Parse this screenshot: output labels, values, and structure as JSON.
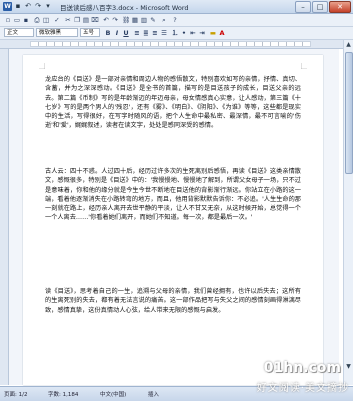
{
  "window": {
    "title": "目送读后感八百字3.docx - Microsoft Word"
  },
  "formatting": {
    "style": "正文",
    "font": "微软雅黑",
    "size": "五号"
  },
  "document": {
    "paragraphs": [
      "龙应台的《目送》是一部对亲情和周边人物的感悟散文，特别喜欢如写的亲情，抒情、真切、含蓄，并为之深深感动。《目送》是全书的首篇，描写的是目送孩子的成长，目送父亲的远去。第二篇《币制》写的是年龄渐迈的年迈母亲，母女情感真心实意，让人感动，第三篇《十七岁》写的是两个男人的'残忍'，还有《雾》、《明白》、《阴阳》、《为谁》等等，这些都是现实中的生活，写得很好，在写字时随风的语，把个人生命中最私密、最深情，最不可言喻的'伤逝'和'爱'，娓娓叙述，读者在读文字，处处是感同深受的感情。",
      "古人云：四十不惑。人过四十后，经历过许多次的生死离别后感悟，再读《目送》这类亲情散文，感慨很多，特别是《目送》中的：'我慢慢地、慢慢地了解到，所谓父女母子一场，只不过是意味着，你和他的缘分就是今生今世不断地在目送他的背影渐行渐远。你站立在小路的这一端，看着他逐渐消失在小路转弯的地方，而且，他用背影默默告诉你：不必追。'人生生命的那一刻就在路上，经历亲人离开去世平静的平淡，让人不甘又无奈，从这时候开始，总觉得一个一个人离去……'你看着她们离开，而她们不知道。每一次，都是最后一次。'",
      "读《目送》，思考着自己的一生，追溯与父母的亲情，我们曾经拥有，也许以后失去；这所有的生离死别的失去，都有着无法言说的痛苦。这一部作品把写与失父之间的感情刻画得淋漓尽致，感情真挚，这份真情动人心弦，给人带来无限的感慨与启发。"
    ]
  },
  "statusbar": {
    "page": "页面: 1/2",
    "words": "字数: 1,184",
    "language": "中文(中国)",
    "mode": "插入"
  },
  "watermark": {
    "site": "01hn.com",
    "tagline": "好文阅读·美文摘抄"
  }
}
